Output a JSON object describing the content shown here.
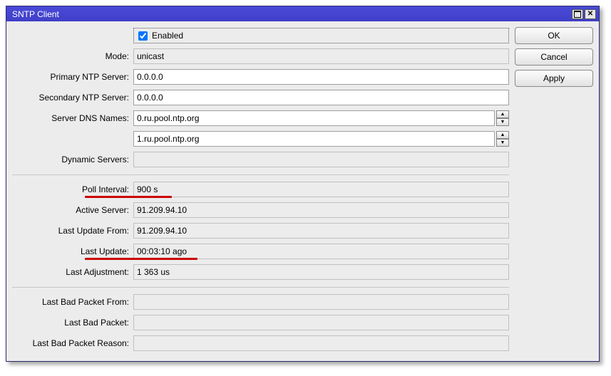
{
  "window": {
    "title": "SNTP Client"
  },
  "buttons": {
    "ok": "OK",
    "cancel": "Cancel",
    "apply": "Apply"
  },
  "labels": {
    "enabled": "Enabled",
    "mode": "Mode:",
    "primary": "Primary NTP Server:",
    "secondary": "Secondary NTP Server:",
    "dns": "Server DNS Names:",
    "dynservers": "Dynamic Servers:",
    "poll": "Poll Interval:",
    "active": "Active Server:",
    "lastfrom": "Last Update From:",
    "lastupdate": "Last Update:",
    "lastadj": "Last Adjustment:",
    "badfrom": "Last Bad Packet From:",
    "badpkt": "Last Bad Packet:",
    "badreason": "Last Bad Packet Reason:"
  },
  "values": {
    "enabled": true,
    "mode": "unicast",
    "primary": "0.0.0.0",
    "secondary": "0.0.0.0",
    "dns1": "0.ru.pool.ntp.org",
    "dns2": "1.ru.pool.ntp.org",
    "dynservers": "",
    "poll": "900 s",
    "active": "91.209.94.10",
    "lastfrom": "91.209.94.10",
    "lastupdate": "00:03:10 ago",
    "lastadj": "1 363 us",
    "badfrom": "",
    "badpkt": "",
    "badreason": ""
  }
}
